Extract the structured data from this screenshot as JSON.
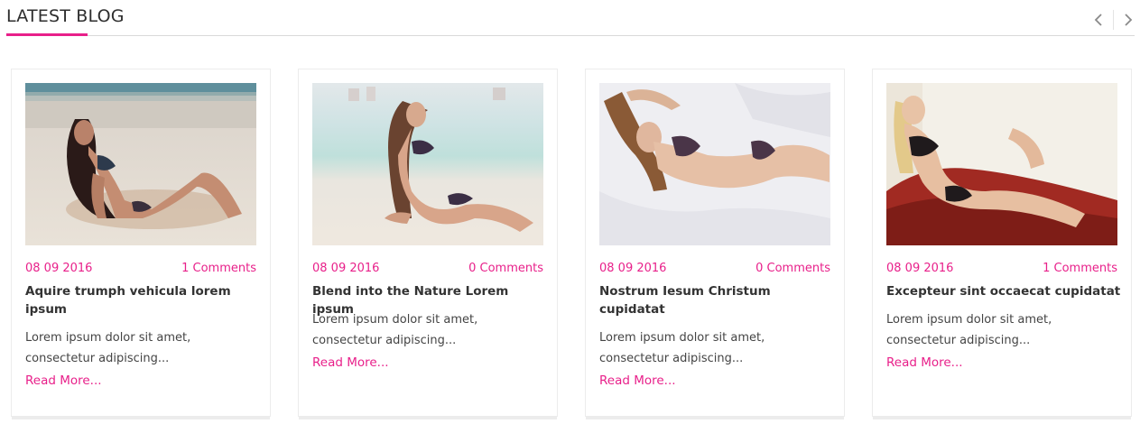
{
  "section": {
    "title": "LATEST BLOG",
    "accent_color": "#e8208a",
    "prev_icon": "chevron-left-icon",
    "next_icon": "chevron-right-icon"
  },
  "posts": [
    {
      "date": "08 09 2016",
      "comments": "1 Comments",
      "title": "Aquire trumph vehicula lorem ipsum",
      "excerpt": "Lorem ipsum dolor sit amet, consectetur adipiscing...",
      "read_more": "Read More...",
      "image": "woman-on-beach-photo"
    },
    {
      "date": "08 09 2016",
      "comments": "0 Comments",
      "title": "Blend into the Nature Lorem ipsum",
      "excerpt": "Lorem ipsum dolor sit amet, consectetur adipiscing...",
      "read_more": "Read More...",
      "image": "woman-sitting-on-sand-photo"
    },
    {
      "date": "08 09 2016",
      "comments": "0 Comments",
      "title": "Nostrum Iesum Christum cupidatat",
      "excerpt": "Lorem ipsum dolor sit amet, consectetur adipiscing...",
      "read_more": "Read More...",
      "image": "woman-lying-on-bed-photo"
    },
    {
      "date": "08 09 2016",
      "comments": "1 Comments",
      "title": "Excepteur sint occaecat cupidatat",
      "excerpt": "Lorem ipsum dolor sit amet, consectetur adipiscing...",
      "read_more": "Read More...",
      "image": "woman-on-red-chair-photo"
    }
  ]
}
